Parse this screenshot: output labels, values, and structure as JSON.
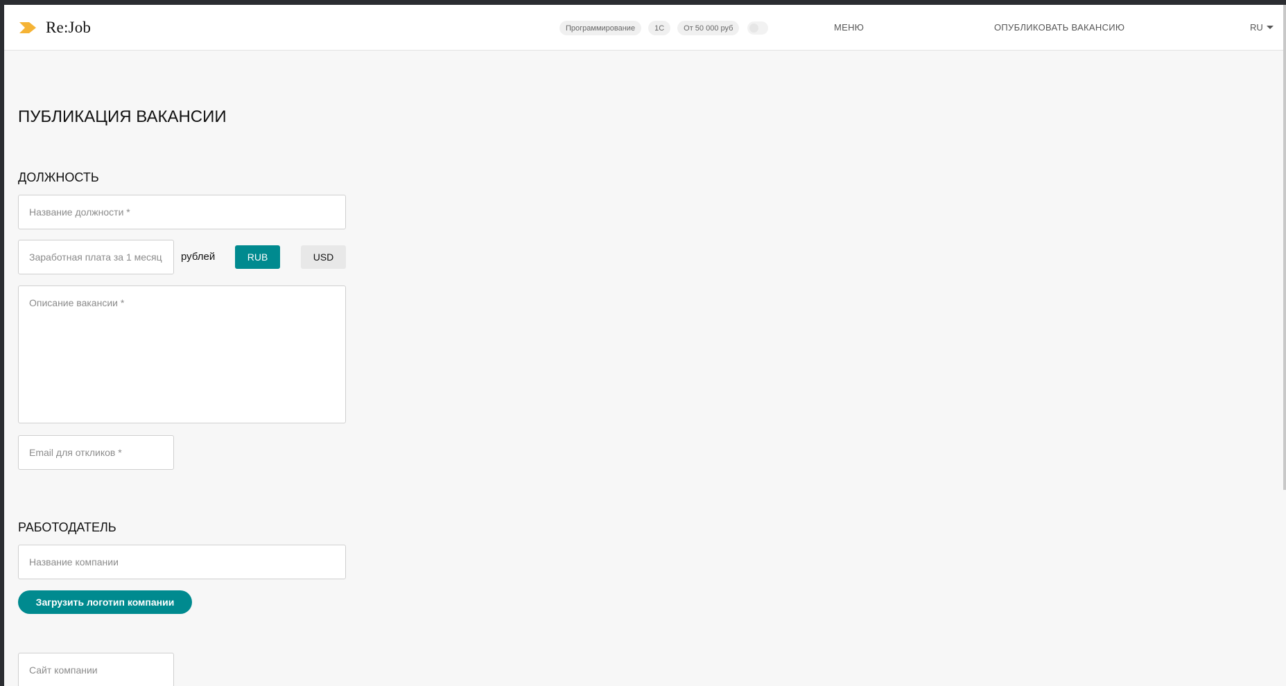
{
  "header": {
    "logo_text": "Re:Job",
    "filters": [
      "Программирование",
      "1С",
      "От 50 000 руб"
    ],
    "toggle_on": false,
    "nav_menu": "МЕНЮ",
    "nav_publish": "ОПУБЛИКОВАТЬ ВАКАНСИЮ",
    "language": "RU"
  },
  "page": {
    "title": "ПУБЛИКАЦИЯ ВАКАНСИИ"
  },
  "position_section": {
    "title": "ДОЛЖНОСТЬ",
    "job_title_placeholder": "Название должности *",
    "salary_placeholder": "Заработная плата за 1 месяц",
    "currency_label": "рублей",
    "currency_rub": "RUB",
    "currency_usd": "USD",
    "selected_currency": "RUB",
    "description_placeholder": "Описание вакансии *",
    "email_placeholder": "Email для откликов *"
  },
  "employer_section": {
    "title": "РАБОТОДАТЕЛЬ",
    "company_name_placeholder": "Название компании",
    "upload_logo_label": "Загрузить логотип компании",
    "website_placeholder": "Сайт компании"
  },
  "colors": {
    "accent": "#008a8f",
    "logo_accent": "#f5b335",
    "background": "#f7f7f7"
  }
}
